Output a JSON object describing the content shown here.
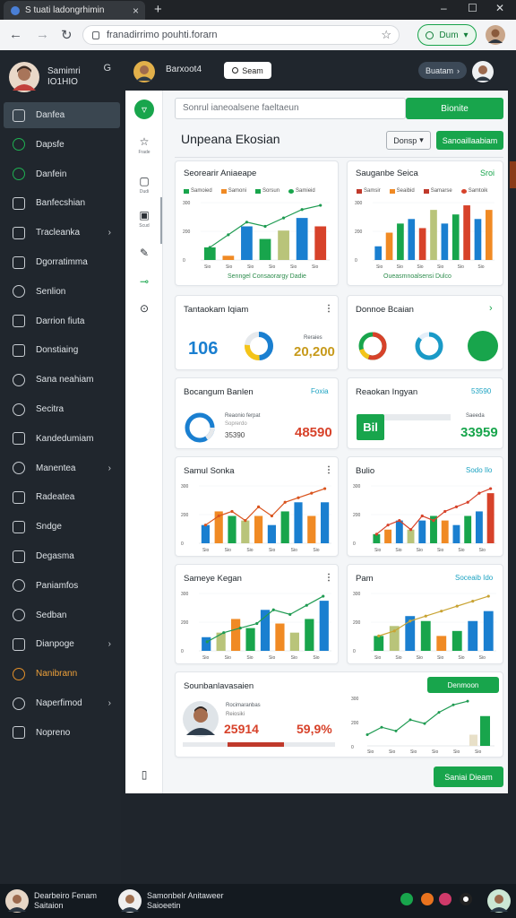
{
  "browser": {
    "tab_title": "S tuati ladongrhimin",
    "tab_close": "×",
    "new_tab": "+",
    "window_min": "–",
    "window_max": "☐",
    "window_close": "✕",
    "url": "franadirrimo pouhti.forarn",
    "ext_label": "Dum"
  },
  "sidebar": {
    "user_name": "Samimri",
    "user_sub": "IO1HIO",
    "items": [
      {
        "label": "Danfea",
        "icon": "dashboard-icon",
        "active": true
      },
      {
        "label": "Dapsfe",
        "icon": "check-circle-icon"
      },
      {
        "label": "Danfein",
        "icon": "check-circle-icon"
      },
      {
        "label": "Banfecshian",
        "icon": "calendar-icon"
      },
      {
        "label": "Tracleanka",
        "icon": "grid-icon",
        "chevron": true
      },
      {
        "label": "Dgorratimma",
        "icon": "monitor-icon"
      },
      {
        "label": "Senlion",
        "icon": "clock-icon"
      },
      {
        "label": "Darrion fiuta",
        "icon": "users-icon"
      },
      {
        "label": "Donstiaing",
        "icon": "window-icon"
      },
      {
        "label": "Sana neahiam",
        "icon": "currency-icon"
      },
      {
        "label": "Secitra",
        "icon": "circle-icon"
      },
      {
        "label": "Kandedumiam",
        "icon": "tools-icon"
      },
      {
        "label": "Manentea",
        "icon": "clock-icon",
        "chevron": true
      },
      {
        "label": "Radeatea",
        "icon": "calendar-icon"
      },
      {
        "label": "Sndge",
        "icon": "box-icon"
      },
      {
        "label": "Degasma",
        "icon": "edit-icon"
      },
      {
        "label": "Paniamfos",
        "icon": "help-icon"
      },
      {
        "label": "Sedban",
        "icon": "clock-icon"
      },
      {
        "label": "Dianpoge",
        "icon": "tag-icon",
        "chevron": true
      },
      {
        "label": "Nanibrann",
        "icon": "sun-icon",
        "orange": true
      },
      {
        "label": "Naperfimod",
        "icon": "globe-icon",
        "chevron": true
      },
      {
        "label": "Nopreno",
        "icon": "document-icon"
      }
    ]
  },
  "topstrip": {
    "name": "Barxoot4",
    "btn": "Seam",
    "pill": "Buatam"
  },
  "rail": {
    "caps": [
      "",
      "Frade",
      "Dudi",
      "Scud",
      "",
      "",
      ""
    ]
  },
  "main": {
    "search_placeholder": "Sonrul ianeoalsene faeltaeun",
    "search_button": "Bionite",
    "page_title": "Unpeana Ekosian",
    "btn_outline": "Donsp",
    "btn_green": "Sanoaillaabiam",
    "card1": {
      "title": "Seorearir Aniaeape",
      "subtitle": "Senngel Consaorargy Dadie",
      "legend": [
        "Samoied",
        "Samoni",
        "Sorsun",
        "Samieid"
      ]
    },
    "card2": {
      "title": "Sauganbe Seica",
      "right": "Sroi",
      "subtitle": "Oueasmnoalsensi Dulco",
      "legend": [
        "Samsir",
        "Seaibid",
        "Samarse",
        "Samtoik"
      ]
    },
    "card3": {
      "title": "Tantaokam Iqiam",
      "num1": "106",
      "num2": "20,200",
      "num2_label": "Reraies"
    },
    "card4": {
      "title": "Donnoe Bcaian"
    },
    "card5": {
      "title": "Bocangum Banlen",
      "right": "Foxia",
      "small": "Reaonio ferpat",
      "small2": "Soprerdo",
      "num1": "35390",
      "num2": "48590"
    },
    "card6": {
      "title": "Reaokan Ingyan",
      "right": "53590",
      "tag": "Bil",
      "small": "Saeeda",
      "num": "33959"
    },
    "card7": {
      "title": "Samul Sonka"
    },
    "card8": {
      "title": "Bulio",
      "right": "Sodo Ilo"
    },
    "card9": {
      "title": "Sameye Kegan"
    },
    "card10": {
      "title": "Pam",
      "right": "Soceaib Ido"
    },
    "card11": {
      "title": "Sounbanlavasaien",
      "btn": "Denmoon",
      "small": "Rocimaranbas",
      "small2": "Reiosiki",
      "num1": "25914",
      "num2": "59,9%"
    },
    "bottom_btn": "Saniai Dieam"
  },
  "footer": {
    "user1_name": "Dearbeiro Fenam",
    "user1_sub": "Saitaion",
    "user2_name": "Samonbelr Anitaweer",
    "user2_sub": "Saioeetin"
  },
  "colors": {
    "green": "#18a54c",
    "blue": "#1a7fd0",
    "orange": "#f08a24",
    "red": "#d7422a",
    "olive": "#b9c47a"
  },
  "chart_data": [
    {
      "type": "bar",
      "title": "Seorearir Aniaeape",
      "series": [
        {
          "name": "Samoied",
          "values": [
            3,
            1,
            8,
            5,
            7,
            10,
            8
          ]
        }
      ],
      "line": [
        3,
        6,
        9,
        8,
        10,
        12,
        13
      ]
    },
    {
      "type": "bar",
      "title": "Sauganbe Seica",
      "series": [
        {
          "name": "Samsir",
          "values": [
            3,
            6,
            8,
            9,
            7,
            11,
            8,
            10,
            12,
            9,
            11
          ]
        }
      ]
    },
    {
      "type": "bar",
      "title": "Samul Sonka",
      "values": [
        4,
        7,
        6,
        5,
        6,
        4,
        7,
        9,
        6,
        9
      ],
      "line": [
        4,
        6,
        7,
        5,
        8,
        6,
        9,
        10,
        11,
        12
      ]
    },
    {
      "type": "bar",
      "title": "Bulio",
      "values": [
        2,
        3,
        5,
        3,
        5,
        6,
        5,
        4,
        6,
        7,
        11
      ],
      "line": [
        2,
        4,
        5,
        3,
        6,
        5,
        7,
        8,
        9,
        11,
        12
      ]
    },
    {
      "type": "bar",
      "title": "Sameye Kegan",
      "values": [
        3,
        4,
        7,
        5,
        9,
        6,
        4,
        7,
        11
      ],
      "line": [
        2,
        4,
        5,
        6,
        9,
        8,
        10,
        12
      ]
    },
    {
      "type": "bar",
      "title": "Pam",
      "values": [
        3,
        5,
        7,
        6,
        3,
        4,
        6,
        8
      ],
      "line": [
        3,
        4,
        6,
        7,
        8,
        9,
        10,
        11
      ]
    },
    {
      "type": "line",
      "title": "Sounbanlavasaien",
      "values": [
        3,
        5,
        4,
        7,
        6,
        9,
        11,
        12
      ],
      "bars": [
        3,
        8
      ]
    }
  ]
}
